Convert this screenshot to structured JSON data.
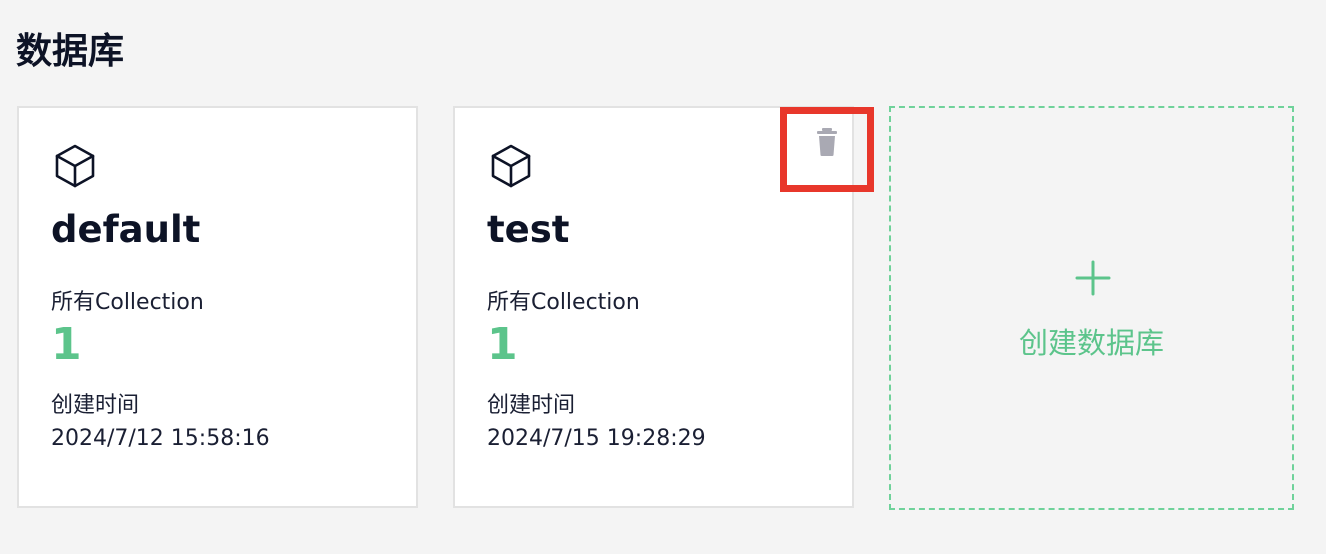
{
  "page": {
    "title": "数据库"
  },
  "databases": [
    {
      "name": "default",
      "collection_label": "所有Collection",
      "collection_count": "1",
      "created_label": "创建时间",
      "created_time": "2024/7/12 15:58:16",
      "icon": "cube-icon"
    },
    {
      "name": "test",
      "collection_label": "所有Collection",
      "collection_count": "1",
      "created_label": "创建时间",
      "created_time": "2024/7/15 19:28:29",
      "icon": "cube-icon",
      "delete_icon": "trash-icon"
    }
  ],
  "create": {
    "label": "创建数据库",
    "icon": "plus-icon"
  },
  "colors": {
    "accent": "#5cc48b",
    "highlight": "#e8372b",
    "text": "#0d1326",
    "trash": "#a9a9b3"
  }
}
